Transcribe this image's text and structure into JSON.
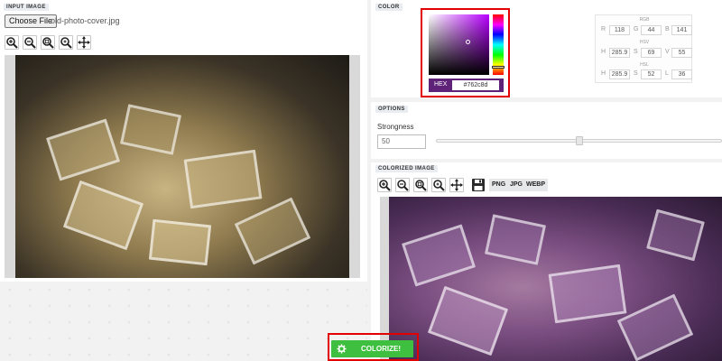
{
  "input": {
    "label": "INPUT IMAGE",
    "choose_file_label": "Choose File",
    "file_name": "old-photo-cover.jpg"
  },
  "color": {
    "label": "COLOR",
    "hex_label": "HEX",
    "hex_value": "#762c8d",
    "selected_color": "#762c8d",
    "rgb": {
      "title": "RGB",
      "r_label": "R",
      "r": "118",
      "g_label": "G",
      "g": "44",
      "b_label": "B",
      "b": "141"
    },
    "hsv": {
      "title": "HSV",
      "h_label": "H",
      "h": "285.9",
      "s_label": "S",
      "s": "69",
      "v_label": "V",
      "v": "55"
    },
    "hsl": {
      "title": "HSL",
      "h_label": "H",
      "h": "285.9",
      "s_label": "S",
      "s": "52",
      "l_label": "L",
      "l": "36"
    }
  },
  "options": {
    "label": "OPTIONS",
    "strongness_label": "Strongness",
    "strongness_value": "50",
    "slider_level": 0.5
  },
  "output": {
    "label": "COLORIZED IMAGE",
    "formats": [
      "PNG",
      "JPG",
      "WEBP"
    ]
  },
  "tools": {
    "icons": [
      "zoom-in-icon",
      "zoom-out-icon",
      "zoom-fit-icon",
      "zoom-reset-icon",
      "move-icon",
      "save-icon"
    ]
  },
  "action": {
    "colorize_label": "COLORIZE!",
    "colorize_color": "#3fbf3f"
  }
}
